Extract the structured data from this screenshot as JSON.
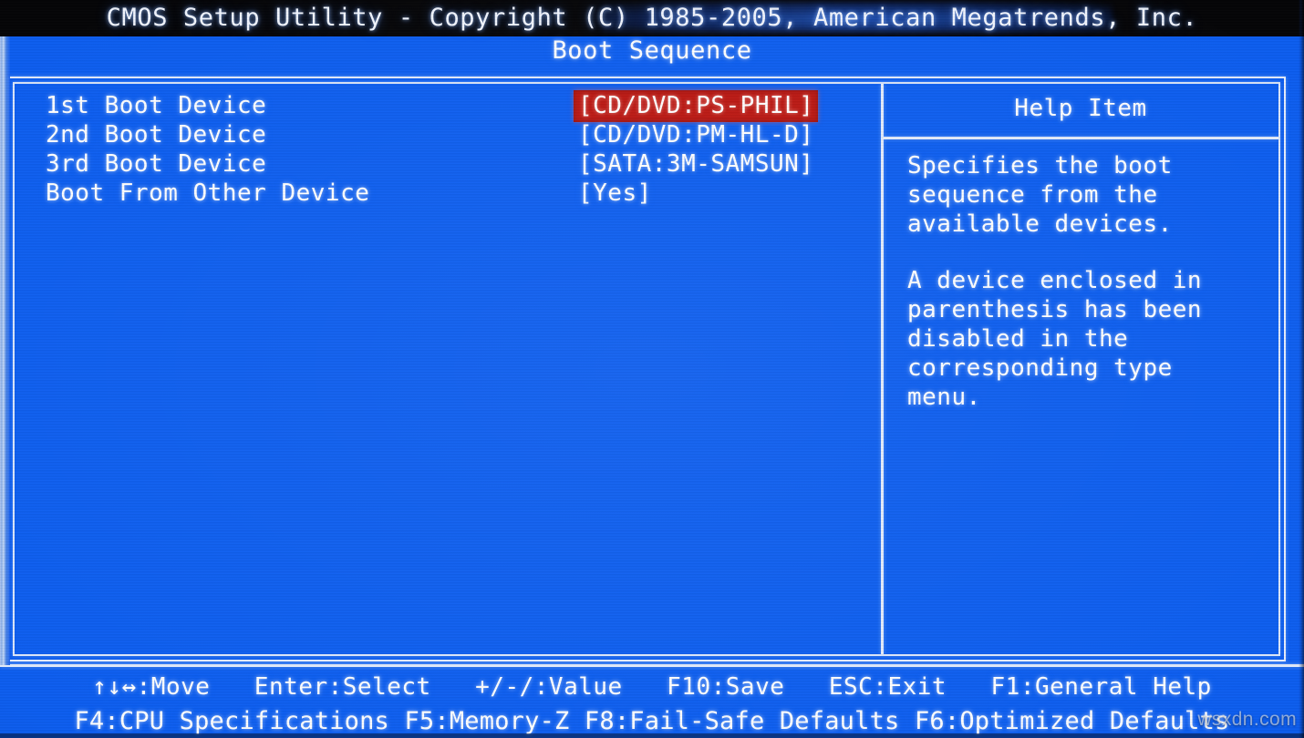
{
  "window": {
    "title": "CMOS Setup Utility - Copyright (C) 1985-2005, American Megatrends, Inc.",
    "subtitle": "Boot Sequence"
  },
  "theme": {
    "background_blue": "#0d5ef0",
    "title_bar_black": "#050507",
    "highlight_red": "#bb1712",
    "text_white": "#ffffff",
    "border_white": "#e3ecfb"
  },
  "settings": {
    "rows": [
      {
        "label": "1st Boot Device",
        "value": "[CD/DVD:PS-PHIL]",
        "selected": true
      },
      {
        "label": "2nd Boot Device",
        "value": "[CD/DVD:PM-HL-D]",
        "selected": false
      },
      {
        "label": "3rd Boot Device",
        "value": "[SATA:3M-SAMSUN]",
        "selected": false
      },
      {
        "label": "Boot From Other Device",
        "value": "[Yes]",
        "selected": false
      }
    ]
  },
  "help": {
    "title": "Help Item",
    "paragraphs": [
      {
        "lines": [
          "Specifies the boot",
          "sequence from the",
          "available devices."
        ]
      },
      {
        "lines": [
          "A device enclosed in",
          "parenthesis has been",
          "disabled in the",
          "corresponding type",
          "menu."
        ]
      }
    ]
  },
  "footer": {
    "line1": "↑↓↔:Move   Enter:Select   +/-/:Value   F10:Save   ESC:Exit   F1:General Help",
    "line2": "F4:CPU Specifications F5:Memory-Z F8:Fail-Safe Defaults F6:Optimized Defaults"
  },
  "watermark": {
    "text": "wsxdn.com"
  }
}
